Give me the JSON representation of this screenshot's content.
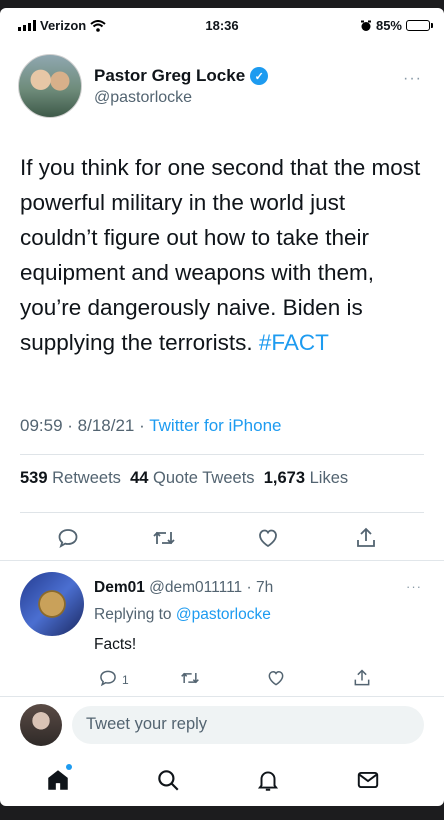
{
  "status_bar": {
    "carrier": "Verizon",
    "time": "18:36",
    "battery_text": "85%",
    "battery_level": 0.85
  },
  "tweet": {
    "author_name": "Pastor Greg Locke",
    "author_handle": "@pastorlocke",
    "more_label": "···",
    "text": "If you think for one second that the most powerful military in the world just couldn’t figure out how to take their equipment and weapons with them, you’re dangerously naive. Biden is supplying the terrorists. ",
    "hashtag": "#FACT",
    "time": "09:59",
    "date": "8/18/21",
    "source": "Twitter for iPhone",
    "stats": {
      "retweets_count": "539",
      "retweets_label": "Retweets",
      "quotes_count": "44",
      "quotes_label": "Quote Tweets",
      "likes_count": "1,673",
      "likes_label": "Likes"
    }
  },
  "reply": {
    "author_name": "Dem01",
    "author_handle": "@dem011111",
    "age": "7h",
    "replying_label": "Replying to",
    "replying_to": "@pastorlocke",
    "text": "Facts!",
    "reply_count": "1",
    "more_label": "···"
  },
  "compose": {
    "placeholder": "Tweet your reply"
  },
  "colors": {
    "accent": "#1d9bf0",
    "text": "#0f1419",
    "muted": "#536471"
  },
  "icons": {
    "actions": [
      "reply-icon",
      "retweet-icon",
      "like-icon",
      "share-icon"
    ],
    "tabs": [
      "home-icon",
      "search-icon",
      "notifications-icon",
      "messages-icon"
    ]
  }
}
